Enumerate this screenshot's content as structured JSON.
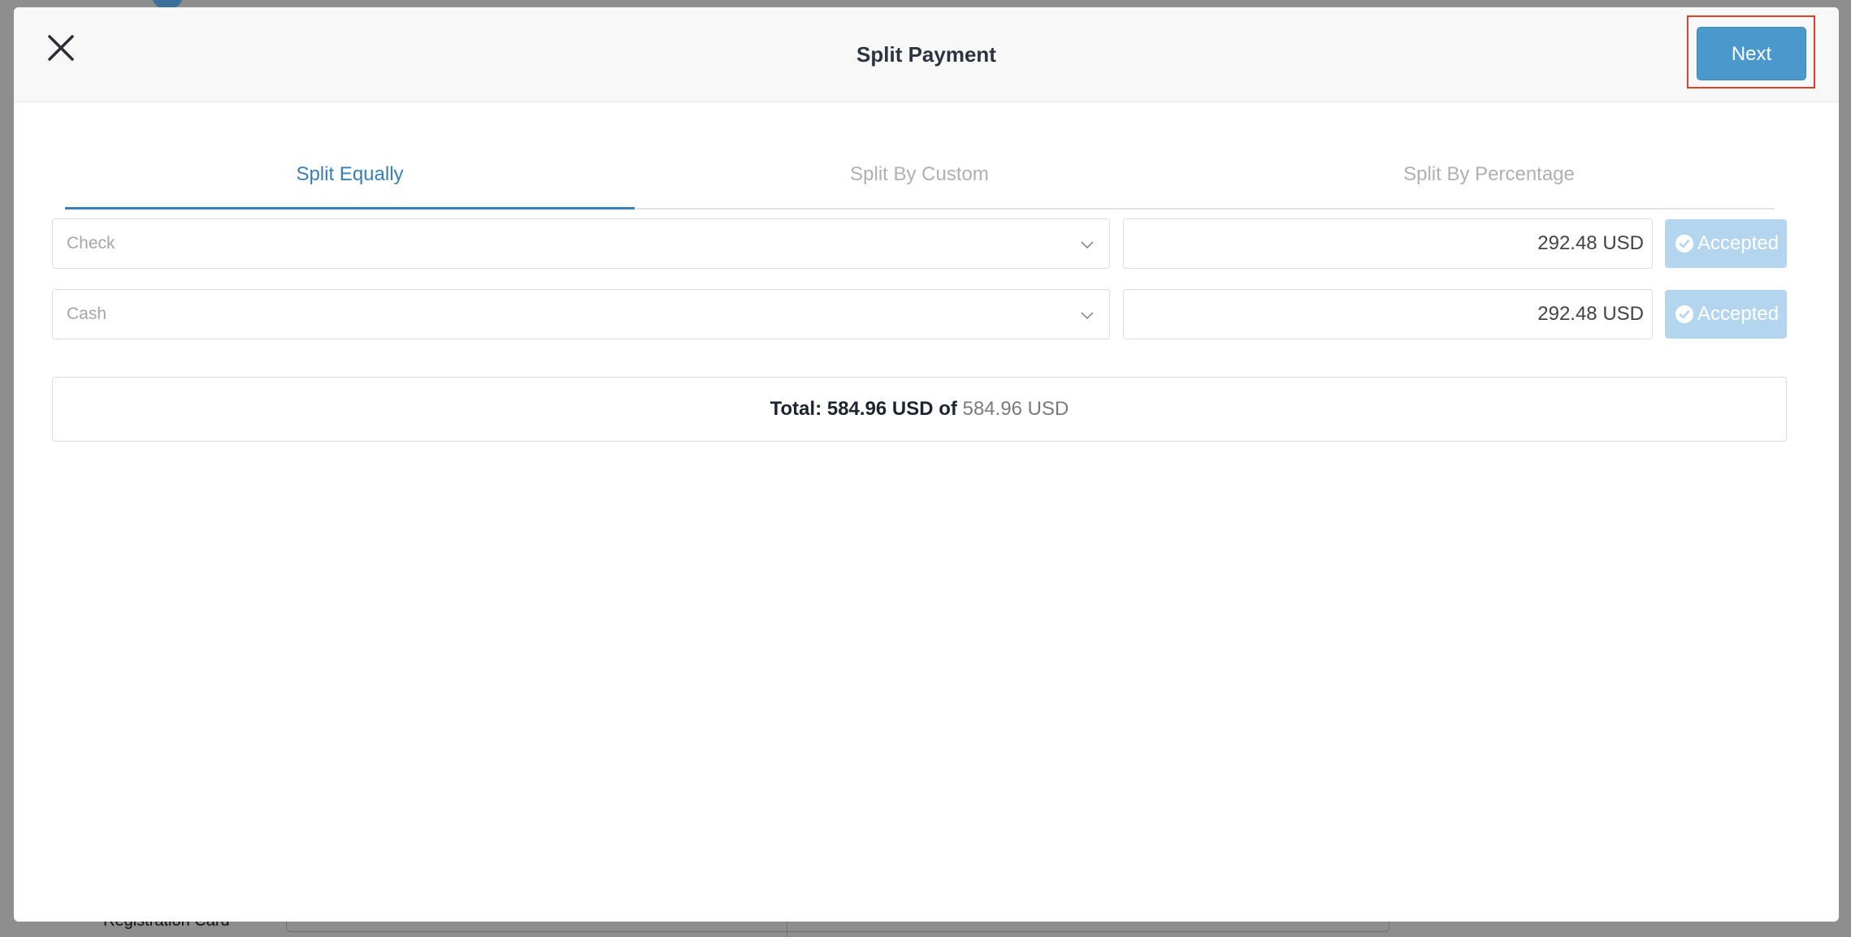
{
  "background": {
    "partial_label": "Registration Card"
  },
  "modal": {
    "title": "Split Payment",
    "next_label": "Next"
  },
  "tabs": [
    {
      "label": "Split Equally",
      "active": true
    },
    {
      "label": "Split By Custom",
      "active": false
    },
    {
      "label": "Split By Percentage",
      "active": false
    }
  ],
  "payments": [
    {
      "method": "Check",
      "amount": "292.48 USD",
      "status": "Accepted"
    },
    {
      "method": "Cash",
      "amount": "292.48 USD",
      "status": "Accepted"
    }
  ],
  "total": {
    "label": "Total:",
    "current": "584.96 USD",
    "of": "of",
    "max": "584.96 USD"
  },
  "colors": {
    "accent": "#3a7fb4",
    "next_button": "#4a98cc",
    "accepted_button": "#b3d6ee",
    "highlight": "#e0402a"
  }
}
